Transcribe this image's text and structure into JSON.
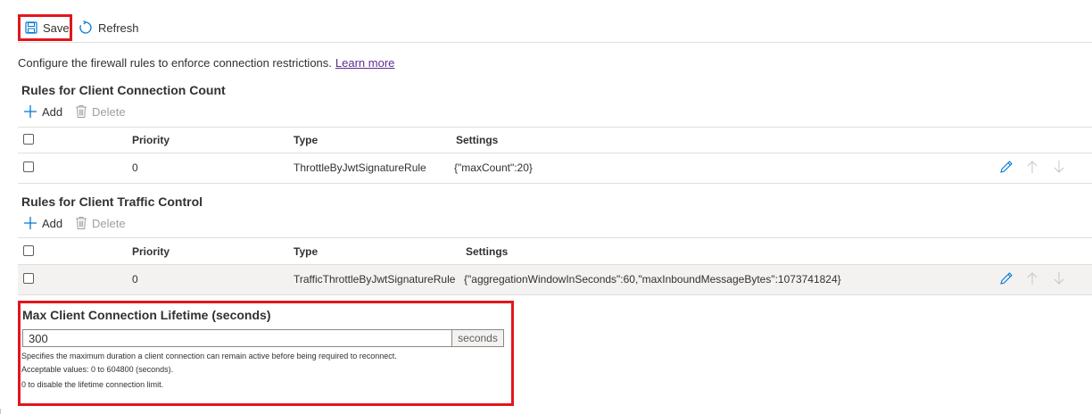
{
  "toolbar": {
    "save_label": "Save",
    "refresh_label": "Refresh",
    "save_icon": "floppy-disk-icon",
    "refresh_icon": "refresh-icon"
  },
  "intro": {
    "text": "Configure the firewall rules to enforce connection restrictions.",
    "link": "Learn more"
  },
  "connection_count": {
    "title": "Rules for Client Connection Count",
    "add_label": "Add",
    "delete_label": "Delete",
    "columns": [
      "Priority",
      "Type",
      "Settings"
    ],
    "rows": [
      {
        "priority": "0",
        "type": "ThrottleByJwtSignatureRule",
        "settings": "{\"maxCount\":20}"
      }
    ]
  },
  "traffic_control": {
    "title": "Rules for Client Traffic Control",
    "add_label": "Add",
    "delete_label": "Delete",
    "columns": [
      "Priority",
      "Type",
      "Settings"
    ],
    "rows": [
      {
        "priority": "0",
        "type": "TrafficThrottleByJwtSignatureRule",
        "settings": "{\"aggregationWindowInSeconds\":60,\"maxInboundMessageBytes\":1073741824}"
      }
    ]
  },
  "lifetime": {
    "title": "Max Client Connection Lifetime (seconds)",
    "value": "300",
    "suffix": "seconds",
    "help": [
      "Specifies the maximum duration a client connection can remain active before being required to reconnect.",
      "Acceptable values: 0 to 604800 (seconds).",
      "0 to disable the lifetime connection limit."
    ]
  },
  "colors": {
    "accent": "#0078d4",
    "highlight": "#e3161d",
    "link": "#5c2d91",
    "disabled": "#a19f9d"
  }
}
